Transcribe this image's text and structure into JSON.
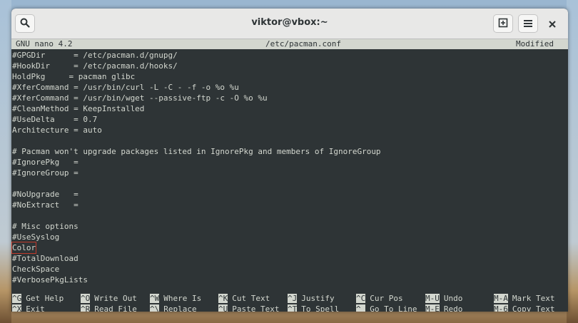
{
  "window": {
    "title": "viktor@vbox:~"
  },
  "titlebar": {
    "search_icon": "search-icon",
    "new_tab_icon": "new-tab-icon",
    "menu_icon": "hamburger-menu-icon",
    "close_icon": "close-icon"
  },
  "nano": {
    "version": "GNU nano 4.2",
    "filename": "/etc/pacman.conf",
    "status": "Modified"
  },
  "lines": [
    "#GPGDir      = /etc/pacman.d/gnupg/",
    "#HookDir     = /etc/pacman.d/hooks/",
    "HoldPkg     = pacman glibc",
    "#XferCommand = /usr/bin/curl -L -C - -f -o %o %u",
    "#XferCommand = /usr/bin/wget --passive-ftp -c -O %o %u",
    "#CleanMethod = KeepInstalled",
    "#UseDelta    = 0.7",
    "Architecture = auto",
    "",
    "# Pacman won't upgrade packages listed in IgnorePkg and members of IgnoreGroup",
    "#IgnorePkg   =",
    "#IgnoreGroup =",
    "",
    "#NoUpgrade   =",
    "#NoExtract   =",
    "",
    "# Misc options",
    "#UseSyslog",
    "Color",
    "#TotalDownload",
    "CheckSpace",
    "#VerbosePkgLists"
  ],
  "shortcuts_row1": [
    {
      "key": "^G",
      "label": "Get Help"
    },
    {
      "key": "^O",
      "label": "Write Out"
    },
    {
      "key": "^W",
      "label": "Where Is"
    },
    {
      "key": "^K",
      "label": "Cut Text"
    },
    {
      "key": "^J",
      "label": "Justify"
    },
    {
      "key": "^C",
      "label": "Cur Pos"
    },
    {
      "key": "M-U",
      "label": "Undo"
    },
    {
      "key": "M-A",
      "label": "Mark Text"
    }
  ],
  "shortcuts_row2": [
    {
      "key": "^X",
      "label": "Exit"
    },
    {
      "key": "^R",
      "label": "Read File"
    },
    {
      "key": "^\\",
      "label": "Replace"
    },
    {
      "key": "^U",
      "label": "Paste Text"
    },
    {
      "key": "^T",
      "label": "To Spell"
    },
    {
      "key": "^_",
      "label": "Go To Line"
    },
    {
      "key": "M-E",
      "label": "Redo"
    },
    {
      "key": "M-6",
      "label": "Copy Text"
    }
  ],
  "colors": {
    "terminal_bg": "#2e3436",
    "terminal_fg": "#d3d7cf",
    "highlight_box": "#c0392b"
  }
}
